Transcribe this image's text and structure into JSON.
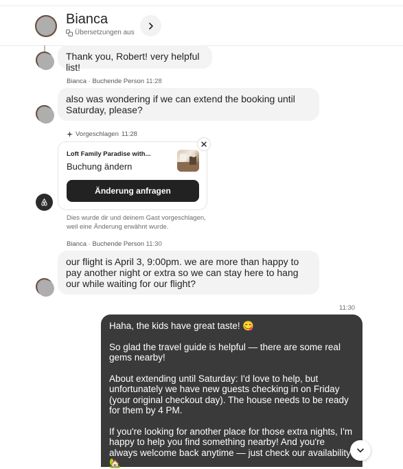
{
  "header": {
    "name": "Bianca",
    "subtitle": "Übersetzungen aus"
  },
  "messages": [
    {
      "text": "Thank you, Robert! very helpful list!"
    },
    {
      "sender": "Bianca · Buchende Person",
      "time": "11:28",
      "text": "also was wondering if we can extend the booking until Saturday, please?"
    },
    {
      "sender": "Bianca · Buchende Person",
      "time": "11:30",
      "text": "our flight is April 3, 9:00pm. we are more than happy to pay another night or extra so we can stay here to hang our while waiting for our flight?"
    }
  ],
  "suggestion": {
    "label": "Vorgeschlagen",
    "time": "11:28",
    "listing_title": "Loft Family Paradise with...",
    "action_title": "Buchung ändern",
    "button_label": "Änderung anfragen",
    "note": "Dies wurde dir und deinem Gast vorgeschlagen, weil eine Änderung erwähnt wurde."
  },
  "outgoing": {
    "time": "11:30",
    "paragraphs": [
      "Haha, the kids have great taste! 😋",
      "So glad the travel guide is helpful — there are some real gems nearby!",
      "About extending until Saturday: I'd love to help, but unfortunately we have new guests checking in on Friday (your original checkout day). The house needs to be ready for them by 4 PM.",
      "If you're looking for another place for those extra nights, I'm happy to help you find something nearby! And you're always welcome back anytime — just check our availability! 🏡"
    ]
  },
  "icons": {
    "header_button": "chevron-right-icon",
    "translate": "translate-icon",
    "sparkle": "sparkle-icon",
    "close": "close-icon",
    "host_logo": "airbnb-logo-icon",
    "scroll": "chevron-down-icon"
  }
}
